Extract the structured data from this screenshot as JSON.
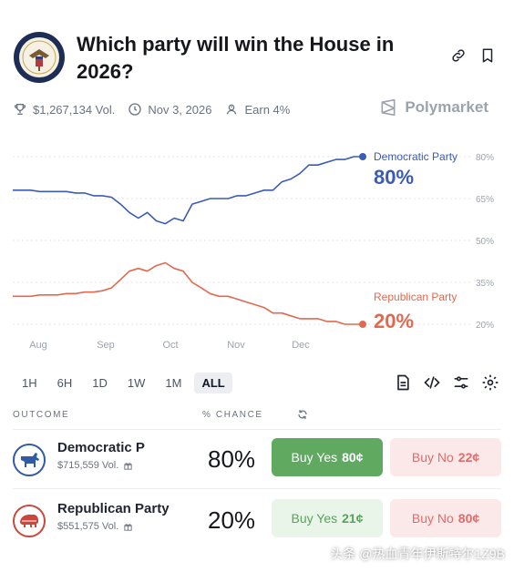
{
  "header": {
    "title": "Which party will win the House in 2026?",
    "icons": [
      "seal-icon",
      "link-icon",
      "bookmark-icon"
    ]
  },
  "meta": {
    "volume": "$1,267,134 Vol.",
    "date": "Nov 3, 2026",
    "earn": "Earn 4%",
    "brand": "Polymarket"
  },
  "chart_data": {
    "type": "line",
    "x_tick_labels": [
      "Aug",
      "Sep",
      "Oct",
      "Nov",
      "Dec"
    ],
    "y_tick_labels": [
      "80%",
      "65%",
      "50%",
      "35%",
      "20%"
    ],
    "ylim": [
      20,
      80
    ],
    "grid": true,
    "series": [
      {
        "name": "Democratic Party",
        "label": "80%",
        "color": "#3b5bb5",
        "values": [
          68,
          68,
          68,
          67.5,
          67.5,
          67.5,
          67.5,
          67,
          67,
          66,
          66,
          65.5,
          63,
          60,
          58,
          60,
          57,
          56,
          58,
          57,
          63,
          64,
          65,
          65,
          65,
          66,
          66,
          67,
          68,
          68,
          71,
          72,
          74,
          77,
          77,
          78,
          79,
          79,
          80,
          80
        ]
      },
      {
        "name": "Republican Party",
        "label": "20%",
        "color": "#e06a50",
        "values": [
          30,
          30,
          30,
          30.5,
          30.5,
          30.5,
          31,
          31,
          31.5,
          31.5,
          32,
          33,
          36,
          39,
          40,
          39,
          41,
          42,
          40,
          39,
          35,
          33,
          31,
          30,
          30,
          29,
          28,
          27,
          26,
          24,
          24,
          23,
          22,
          22,
          22,
          21,
          21,
          20,
          20,
          20
        ]
      }
    ]
  },
  "ranges": {
    "items": [
      "1H",
      "6H",
      "1D",
      "1W",
      "1M",
      "ALL"
    ],
    "active": "ALL"
  },
  "table": {
    "col_outcome": "OUTCOME",
    "col_chance": "% CHANCE",
    "rows": [
      {
        "name": "Democratic P",
        "volume": "$715,559 Vol.",
        "chance": "80%",
        "yes_label": "Buy Yes",
        "yes_price": "80¢",
        "no_label": "Buy No",
        "no_price": "22¢"
      },
      {
        "name": "Republican Party",
        "volume": "$551,575 Vol.",
        "chance": "20%",
        "yes_label": "Buy Yes",
        "yes_price": "21¢",
        "no_label": "Buy No",
        "no_price": "80¢"
      }
    ]
  },
  "watermark": "头条 @热血青年伊斯特尔1Z9B"
}
